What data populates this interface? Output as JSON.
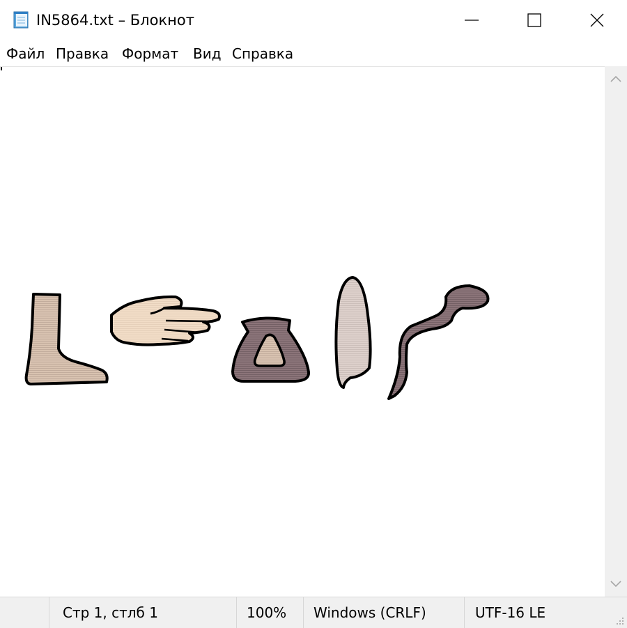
{
  "window": {
    "title": "IN5864.txt – Блокнот",
    "app_icon": "notepad-icon",
    "controls": {
      "minimize": "minimize-icon",
      "maximize": "maximize-icon",
      "close": "close-icon"
    }
  },
  "menu": {
    "items": [
      "Файл",
      "Правка",
      "Формат",
      "Вид",
      "Справка"
    ]
  },
  "editor": {
    "content": "",
    "hieroglyphs": [
      "foot-glyph-icon",
      "hand-glyph-icon",
      "pot-glyph-icon",
      "reed-leaf-glyph-icon",
      "cobra-glyph-icon"
    ]
  },
  "status": {
    "position": "Стр 1, стлб 1",
    "zoom": "100%",
    "line_endings": "Windows (CRLF)",
    "encoding": "UTF-16 LE"
  },
  "colors": {
    "chrome_bg": "#f0f0f0",
    "editor_bg": "#ffffff",
    "glyph_light": "#d8c2b0",
    "glyph_hand": "#f1dcc6",
    "glyph_dark": "#8b7479"
  }
}
